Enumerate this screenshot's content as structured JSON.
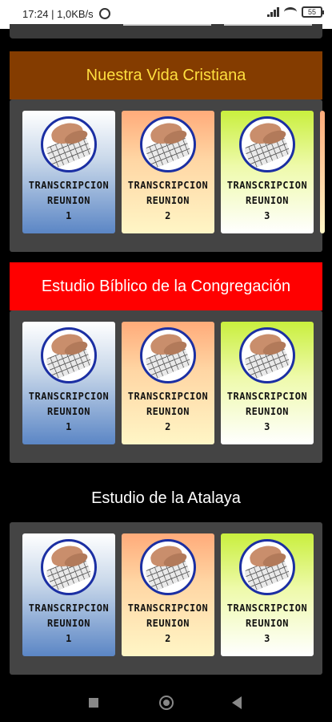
{
  "status": {
    "text": "17:24 | 1,0KB/s",
    "battery": "55"
  },
  "sections": [
    {
      "title": "Nuestra Vida Cristiana",
      "cards": [
        {
          "line1": "TRANSCRIPCION",
          "line2": "REUNION",
          "line3": "1"
        },
        {
          "line1": "TRANSCRIPCION",
          "line2": "REUNION",
          "line3": "2"
        },
        {
          "line1": "TRANSCRIPCION",
          "line2": "REUNION",
          "line3": "3"
        }
      ]
    },
    {
      "title": "Estudio Bíblico de la Congregación",
      "cards": [
        {
          "line1": "TRANSCRIPCION",
          "line2": "REUNION",
          "line3": "1"
        },
        {
          "line1": "TRANSCRIPCION",
          "line2": "REUNION",
          "line3": "2"
        },
        {
          "line1": "TRANSCRIPCION",
          "line2": "REUNION",
          "line3": "3"
        }
      ]
    },
    {
      "title": "Estudio de la Atalaya",
      "cards": [
        {
          "line1": "TRANSCRIPCION",
          "line2": "REUNION",
          "line3": "1"
        },
        {
          "line1": "TRANSCRIPCION",
          "line2": "REUNION",
          "line3": "2"
        },
        {
          "line1": "TRANSCRIPCION",
          "line2": "REUNION",
          "line3": "3"
        }
      ]
    }
  ],
  "colors": {
    "brown_header": "#843c00",
    "brown_header_text": "#ffdf3f",
    "red_header": "#ff0000",
    "panel": "#444444"
  },
  "icons": [
    "alarm-icon",
    "signal-icon",
    "wifi-icon",
    "battery-icon",
    "typing-hands-icon",
    "nav-recents-icon",
    "nav-home-icon",
    "nav-back-icon"
  ]
}
